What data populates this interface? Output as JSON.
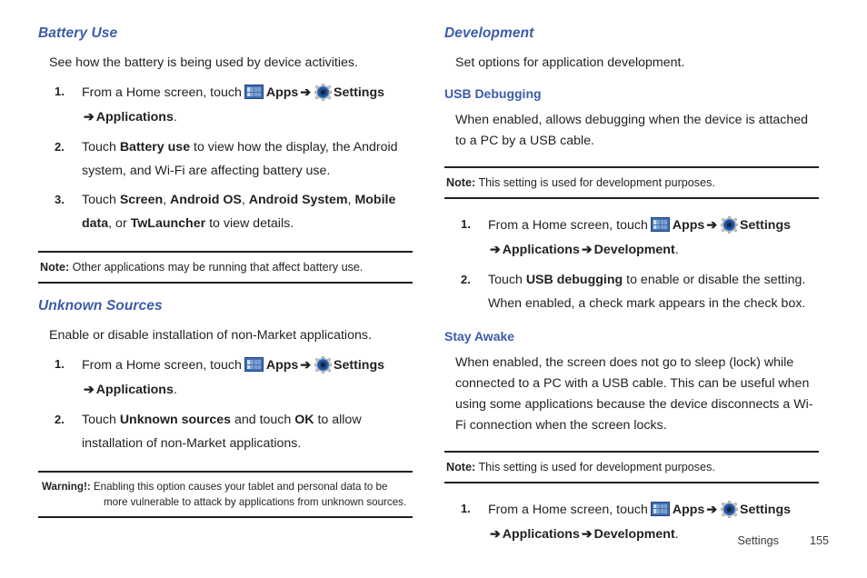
{
  "meta": {
    "accent_blue": "#3c5ba9",
    "text_color": "#231f20",
    "icon_apps_name": "apps-grid-icon",
    "icon_gear_name": "settings-gear-icon"
  },
  "left_column": {
    "battery_use": {
      "heading": "Battery Use",
      "intro": "See how the battery is being used by device activities.",
      "steps": [
        {
          "num": "1.",
          "pre": "From a Home screen, touch",
          "apps_label": "Apps",
          "arrow1": "➔",
          "settings_label": "Settings",
          "arrow2": "➔",
          "tail_bold": "Applications",
          "tail_end": "."
        },
        {
          "num": "2.",
          "text_1": "Touch ",
          "bold_1": "Battery use",
          "text_2": " to view how the display, the Android system, and Wi-Fi are affecting battery use."
        },
        {
          "num": "3.",
          "text_1": "Touch ",
          "bold_1": "Screen",
          "text_2": ", ",
          "bold_2": "Android OS",
          "text_3": ", ",
          "bold_3": "Android System",
          "text_4": ", ",
          "bold_4": "Mobile data",
          "text_5": ", or ",
          "bold_5": "TwLauncher",
          "text_6": " to view details."
        }
      ],
      "note": {
        "label": "Note:",
        "text": " Other applications may be running that affect battery use."
      }
    },
    "unknown_sources": {
      "heading": "Unknown Sources",
      "intro": "Enable or disable installation of non-Market applications.",
      "steps": [
        {
          "num": "1.",
          "pre": "From a Home screen, touch",
          "apps_label": "Apps",
          "arrow1": "➔",
          "settings_label": "Settings",
          "arrow2": "➔",
          "tail_bold": "Applications",
          "tail_end": "."
        },
        {
          "num": "2.",
          "text_1": "Touch ",
          "bold_1": "Unknown sources",
          "text_2": " and touch ",
          "bold_2": "OK",
          "text_3": " to allow installation of non-Market applications."
        }
      ],
      "warning": {
        "label": "Warning!:",
        "text": " Enabling this option causes your tablet and personal data to be more vulnerable to attack by applications from unknown sources."
      }
    }
  },
  "right_column": {
    "development": {
      "heading": "Development",
      "intro": "Set options for application development."
    },
    "usb_debugging": {
      "heading": "USB Debugging",
      "body": "When enabled, allows debugging when the device is attached to a PC by a USB cable.",
      "note": {
        "label": "Note:",
        "text": " This setting is used for development purposes."
      },
      "steps": [
        {
          "num": "1.",
          "pre": "From a Home screen, touch",
          "apps_label": "Apps",
          "arrow1": "➔",
          "settings_label": "Settings",
          "arrow2": "➔",
          "tail_bold": "Applications",
          "arrow3": "➔",
          "tail_bold2": "Development",
          "tail_end": "."
        },
        {
          "num": "2.",
          "text_1": "Touch ",
          "bold_1": "USB debugging",
          "text_2": " to enable or disable the setting. When enabled, a check mark appears in the check box."
        }
      ]
    },
    "stay_awake": {
      "heading": "Stay Awake",
      "body": "When enabled, the screen does not go to sleep (lock) while connected to a PC with a USB cable. This can be useful when using some applications because the device disconnects a Wi-Fi connection when the screen locks.",
      "note": {
        "label": "Note:",
        "text": " This setting is used for development purposes."
      },
      "steps": [
        {
          "num": "1.",
          "pre": "From a Home screen, touch",
          "apps_label": "Apps",
          "arrow1": "➔",
          "settings_label": "Settings",
          "arrow2": "➔",
          "tail_bold": "Applications",
          "arrow3": "➔",
          "tail_bold2": "Development",
          "tail_end": "."
        }
      ]
    }
  },
  "footer": {
    "chapter": "Settings",
    "page_number": "155"
  }
}
